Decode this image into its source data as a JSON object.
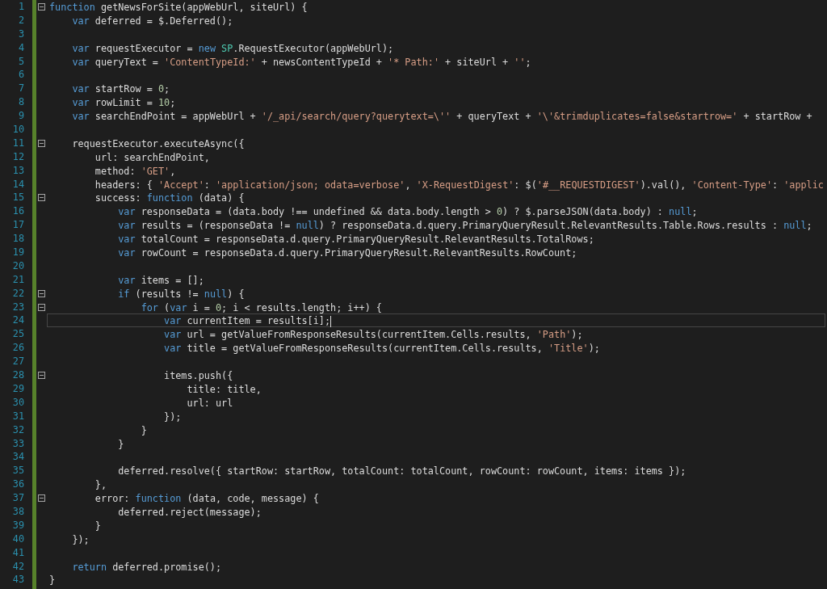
{
  "lines": [
    {
      "number": "1",
      "foldable": true,
      "tokens": [
        {
          "kind": "keyword",
          "text": "function"
        },
        {
          "kind": "plain",
          "text": " getNewsForSite(appWebUrl, siteUrl) {"
        }
      ]
    },
    {
      "number": "2",
      "tokens": [
        {
          "kind": "keyword",
          "text": "    var"
        },
        {
          "kind": "plain",
          "text": " deferred = $.Deferred();"
        }
      ]
    },
    {
      "number": "3"
    },
    {
      "number": "4",
      "tokens": [
        {
          "kind": "keyword",
          "text": "    var"
        },
        {
          "kind": "plain",
          "text": " requestExecutor = "
        },
        {
          "kind": "keyword",
          "text": "new"
        },
        {
          "kind": "type",
          "text": " SP"
        },
        {
          "kind": "plain",
          "text": ".RequestExecutor(appWebUrl);"
        }
      ]
    },
    {
      "number": "5",
      "tokens": [
        {
          "kind": "keyword",
          "text": "    var"
        },
        {
          "kind": "plain",
          "text": " queryText = "
        },
        {
          "kind": "string",
          "text": "'ContentTypeId:'"
        },
        {
          "kind": "plain",
          "text": " + newsContentTypeId + "
        },
        {
          "kind": "string",
          "text": "'* Path:'"
        },
        {
          "kind": "plain",
          "text": " + siteUrl + "
        },
        {
          "kind": "string",
          "text": "''"
        },
        {
          "kind": "plain",
          "text": ";"
        }
      ]
    },
    {
      "number": "6"
    },
    {
      "number": "7",
      "tokens": [
        {
          "kind": "keyword",
          "text": "    var"
        },
        {
          "kind": "plain",
          "text": " startRow = "
        },
        {
          "kind": "number",
          "text": "0"
        },
        {
          "kind": "plain",
          "text": ";"
        }
      ]
    },
    {
      "number": "8",
      "tokens": [
        {
          "kind": "keyword",
          "text": "    var"
        },
        {
          "kind": "plain",
          "text": " rowLimit = "
        },
        {
          "kind": "number",
          "text": "10"
        },
        {
          "kind": "plain",
          "text": ";"
        }
      ]
    },
    {
      "number": "9",
      "tokens": [
        {
          "kind": "keyword",
          "text": "    var"
        },
        {
          "kind": "plain",
          "text": " searchEndPoint = appWebUrl + "
        },
        {
          "kind": "string",
          "text": "'/_api/search/query?querytext=\\''"
        },
        {
          "kind": "plain",
          "text": " + queryText + "
        },
        {
          "kind": "string",
          "text": "'\\'&trimduplicates=false&startrow='"
        },
        {
          "kind": "plain",
          "text": " + startRow +"
        }
      ]
    },
    {
      "number": "10"
    },
    {
      "number": "11",
      "foldable": true,
      "tokens": [
        {
          "kind": "plain",
          "text": "    requestExecutor.executeAsync({"
        }
      ]
    },
    {
      "number": "12",
      "tokens": [
        {
          "kind": "plain",
          "text": "        url: searchEndPoint,"
        }
      ]
    },
    {
      "number": "13",
      "tokens": [
        {
          "kind": "plain",
          "text": "        method: "
        },
        {
          "kind": "string",
          "text": "'GET'"
        },
        {
          "kind": "plain",
          "text": ","
        }
      ]
    },
    {
      "number": "14",
      "tokens": [
        {
          "kind": "plain",
          "text": "        headers: { "
        },
        {
          "kind": "string",
          "text": "'Accept'"
        },
        {
          "kind": "plain",
          "text": ": "
        },
        {
          "kind": "string",
          "text": "'application/json; odata=verbose'"
        },
        {
          "kind": "plain",
          "text": ", "
        },
        {
          "kind": "string",
          "text": "'X-RequestDigest'"
        },
        {
          "kind": "plain",
          "text": ": $("
        },
        {
          "kind": "string",
          "text": "'#__REQUESTDIGEST'"
        },
        {
          "kind": "plain",
          "text": ").val(), "
        },
        {
          "kind": "string",
          "text": "'Content-Type'"
        },
        {
          "kind": "plain",
          "text": ": "
        },
        {
          "kind": "string",
          "text": "'applic"
        }
      ]
    },
    {
      "number": "15",
      "foldable": true,
      "tokens": [
        {
          "kind": "plain",
          "text": "        success: "
        },
        {
          "kind": "keyword",
          "text": "function"
        },
        {
          "kind": "plain",
          "text": " (data) {"
        }
      ]
    },
    {
      "number": "16",
      "tokens": [
        {
          "kind": "keyword",
          "text": "            var"
        },
        {
          "kind": "plain",
          "text": " responseData = (data.body !== undefined && data.body.length > "
        },
        {
          "kind": "number",
          "text": "0"
        },
        {
          "kind": "plain",
          "text": ") ? $.parseJSON(data.body) : "
        },
        {
          "kind": "keyword",
          "text": "null"
        },
        {
          "kind": "plain",
          "text": ";"
        }
      ]
    },
    {
      "number": "17",
      "tokens": [
        {
          "kind": "keyword",
          "text": "            var"
        },
        {
          "kind": "plain",
          "text": " results = (responseData != "
        },
        {
          "kind": "keyword",
          "text": "null"
        },
        {
          "kind": "plain",
          "text": ") ? responseData.d.query.PrimaryQueryResult.RelevantResults.Table.Rows.results : "
        },
        {
          "kind": "keyword",
          "text": "null"
        },
        {
          "kind": "plain",
          "text": ";"
        }
      ]
    },
    {
      "number": "18",
      "tokens": [
        {
          "kind": "keyword",
          "text": "            var"
        },
        {
          "kind": "plain",
          "text": " totalCount = responseData.d.query.PrimaryQueryResult.RelevantResults.TotalRows;"
        }
      ]
    },
    {
      "number": "19",
      "tokens": [
        {
          "kind": "keyword",
          "text": "            var"
        },
        {
          "kind": "plain",
          "text": " rowCount = responseData.d.query.PrimaryQueryResult.RelevantResults.RowCount;"
        }
      ]
    },
    {
      "number": "20"
    },
    {
      "number": "21",
      "tokens": [
        {
          "kind": "keyword",
          "text": "            var"
        },
        {
          "kind": "plain",
          "text": " items = [];"
        }
      ]
    },
    {
      "number": "22",
      "foldable": true,
      "tokens": [
        {
          "kind": "keyword",
          "text": "            if"
        },
        {
          "kind": "plain",
          "text": " (results != "
        },
        {
          "kind": "keyword",
          "text": "null"
        },
        {
          "kind": "plain",
          "text": ") {"
        }
      ]
    },
    {
      "number": "23",
      "foldable": true,
      "tokens": [
        {
          "kind": "keyword",
          "text": "                for"
        },
        {
          "kind": "plain",
          "text": " ("
        },
        {
          "kind": "keyword",
          "text": "var"
        },
        {
          "kind": "plain",
          "text": " i = "
        },
        {
          "kind": "number",
          "text": "0"
        },
        {
          "kind": "plain",
          "text": "; i < results.length; i++) {"
        }
      ]
    },
    {
      "number": "24",
      "current": true,
      "tokens": [
        {
          "kind": "keyword",
          "text": "                    var"
        },
        {
          "kind": "plain",
          "text": " currentItem = results[i];"
        }
      ]
    },
    {
      "number": "25",
      "tokens": [
        {
          "kind": "keyword",
          "text": "                    var"
        },
        {
          "kind": "plain",
          "text": " url = getValueFromResponseResults(currentItem.Cells.results, "
        },
        {
          "kind": "string",
          "text": "'Path'"
        },
        {
          "kind": "plain",
          "text": ");"
        }
      ]
    },
    {
      "number": "26",
      "tokens": [
        {
          "kind": "keyword",
          "text": "                    var"
        },
        {
          "kind": "plain",
          "text": " title = getValueFromResponseResults(currentItem.Cells.results, "
        },
        {
          "kind": "string",
          "text": "'Title'"
        },
        {
          "kind": "plain",
          "text": ");"
        }
      ]
    },
    {
      "number": "27"
    },
    {
      "number": "28",
      "foldable": true,
      "tokens": [
        {
          "kind": "plain",
          "text": "                    items.push({"
        }
      ]
    },
    {
      "number": "29",
      "tokens": [
        {
          "kind": "plain",
          "text": "                        title: title,"
        }
      ]
    },
    {
      "number": "30",
      "tokens": [
        {
          "kind": "plain",
          "text": "                        url: url"
        }
      ]
    },
    {
      "number": "31",
      "tokens": [
        {
          "kind": "plain",
          "text": "                    });"
        }
      ]
    },
    {
      "number": "32",
      "tokens": [
        {
          "kind": "plain",
          "text": "                }"
        }
      ]
    },
    {
      "number": "33",
      "tokens": [
        {
          "kind": "plain",
          "text": "            }"
        }
      ]
    },
    {
      "number": "34"
    },
    {
      "number": "35",
      "tokens": [
        {
          "kind": "plain",
          "text": "            deferred.resolve({ startRow: startRow, totalCount: totalCount, rowCount: rowCount, items: items });"
        }
      ]
    },
    {
      "number": "36",
      "tokens": [
        {
          "kind": "plain",
          "text": "        },"
        }
      ]
    },
    {
      "number": "37",
      "foldable": true,
      "tokens": [
        {
          "kind": "plain",
          "text": "        error: "
        },
        {
          "kind": "keyword",
          "text": "function"
        },
        {
          "kind": "plain",
          "text": " (data, code, message) {"
        }
      ]
    },
    {
      "number": "38",
      "tokens": [
        {
          "kind": "plain",
          "text": "            deferred.reject(message);"
        }
      ]
    },
    {
      "number": "39",
      "tokens": [
        {
          "kind": "plain",
          "text": "        }"
        }
      ]
    },
    {
      "number": "40",
      "tokens": [
        {
          "kind": "plain",
          "text": "    });"
        }
      ]
    },
    {
      "number": "41"
    },
    {
      "number": "42",
      "tokens": [
        {
          "kind": "keyword",
          "text": "    return"
        },
        {
          "kind": "plain",
          "text": " deferred.promise();"
        }
      ]
    },
    {
      "number": "43",
      "tokens": [
        {
          "kind": "plain",
          "text": "}"
        }
      ]
    }
  ]
}
